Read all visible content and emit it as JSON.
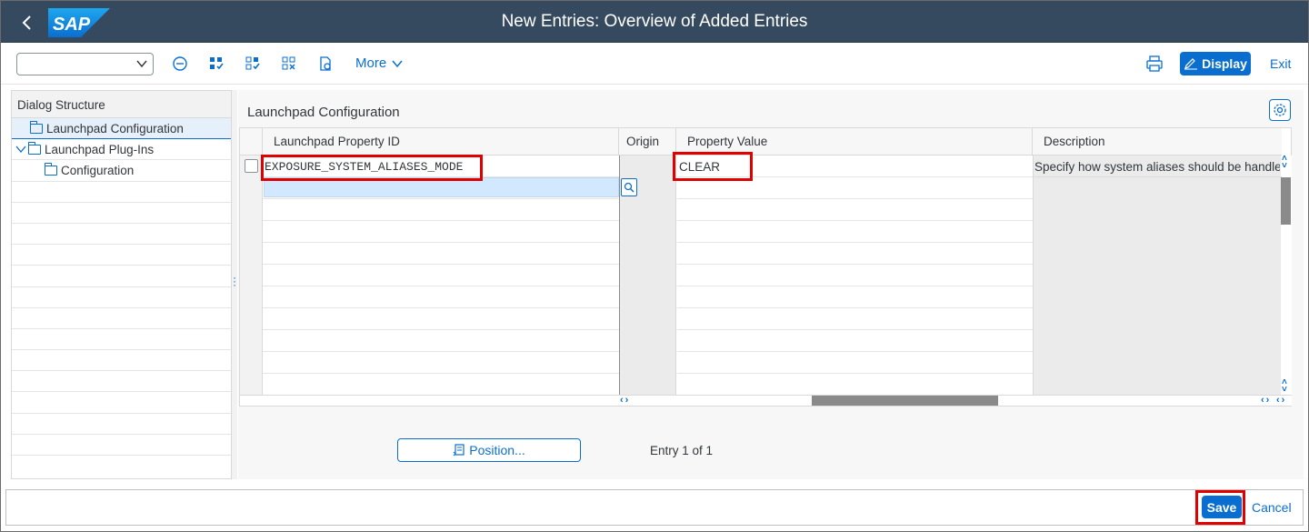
{
  "shell": {
    "title": "New Entries: Overview of Added Entries",
    "logo_text": "SAP"
  },
  "toolbar": {
    "command_field_value": "",
    "more_label": "More",
    "display_label": "Display",
    "exit_label": "Exit",
    "icons": [
      "minus-circle-icon",
      "select-all-icon",
      "select-block-icon",
      "deselect-all-icon",
      "configure-icon",
      "print-icon",
      "display-edit-icon"
    ]
  },
  "dialog_structure": {
    "header": "Dialog Structure",
    "items": [
      {
        "label": "Launchpad Configuration",
        "selected": true,
        "level": 1
      },
      {
        "label": "Launchpad Plug-Ins",
        "expanded": true,
        "level": 0
      },
      {
        "label": "Configuration",
        "level": 2
      }
    ]
  },
  "panel": {
    "title": "Launchpad Configuration"
  },
  "table": {
    "columns": [
      "Launchpad Property ID",
      "Origin",
      "Property Value",
      "Description"
    ],
    "rows": [
      {
        "property_id": "EXPOSURE_SYSTEM_ALIASES_MODE",
        "origin": "",
        "property_value": "CLEAR",
        "description": "Specify how system aliases should be handled"
      }
    ]
  },
  "position_label": "Position...",
  "entry_info": "Entry 1 of 1",
  "footer": {
    "save_label": "Save",
    "cancel_label": "Cancel"
  },
  "colors": {
    "shell_bg": "#354a5f",
    "accent": "#0a6ed1",
    "highlight_red": "#e00000"
  }
}
